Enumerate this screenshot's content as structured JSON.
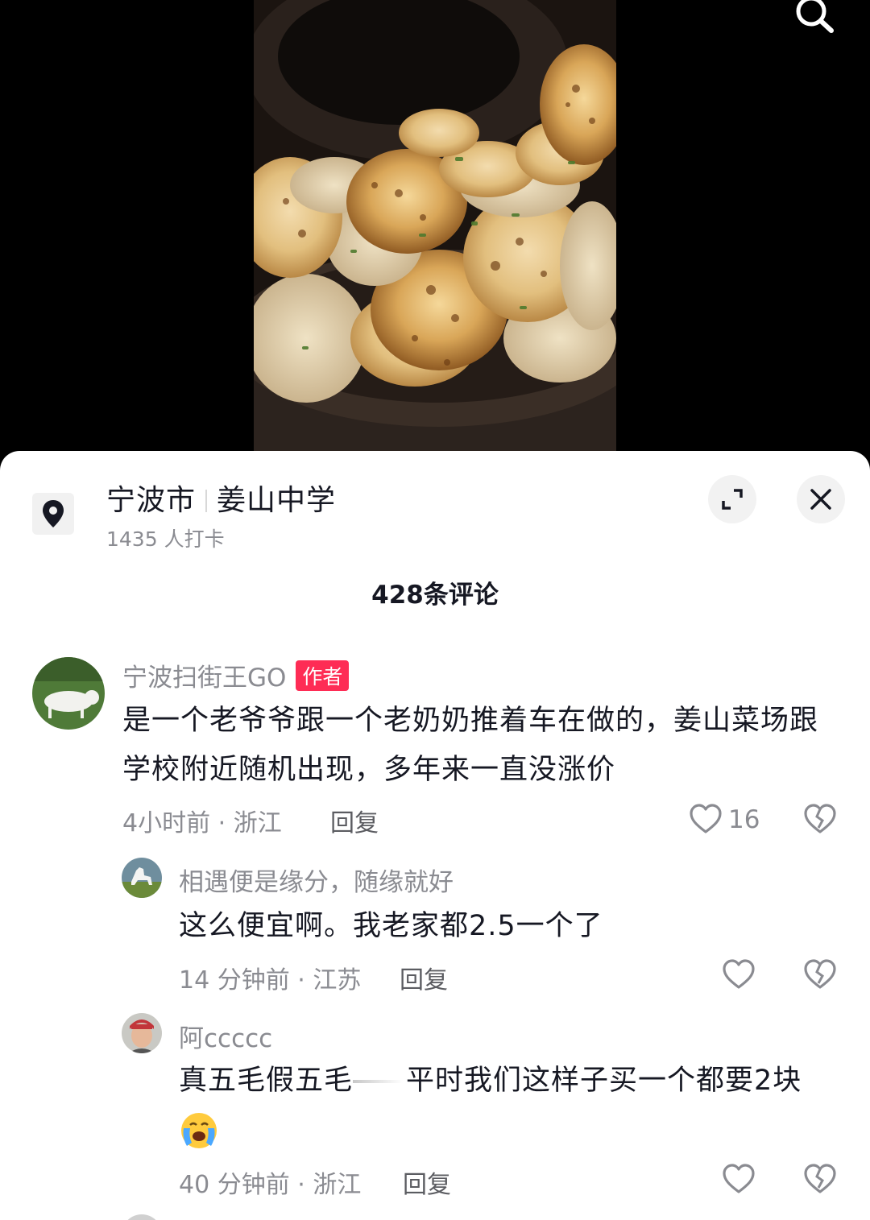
{
  "video": {
    "search_icon": "search-icon"
  },
  "location": {
    "icon": "location-pin-icon",
    "city": "宁波市",
    "place": "姜山中学",
    "checkins": "1435 人打卡"
  },
  "header": {
    "comment_count": "428条评论",
    "expand_icon": "expand-icon",
    "close_icon": "close-icon"
  },
  "comments": [
    {
      "user": "宁波扫街王GO",
      "badge": "作者",
      "text": "是一个老爷爷跟一个老奶奶推着车在做的，姜山菜场跟学校附近随机出现，多年来一直没涨价",
      "meta": "4小时前 · 浙江",
      "reply": "回复",
      "likes": "16"
    },
    {
      "user": "相遇便是缘分，随缘就好",
      "text": "这么便宜啊。我老家都2.5一个了",
      "meta": "14 分钟前 · 江苏",
      "reply": "回复"
    },
    {
      "user": "阿ccccc",
      "text_a": "真五毛假五毛",
      "text_b": "平时我们这样子买一个都要2块",
      "emoji": "crying-emoji",
      "meta": "40 分钟前 · 浙江",
      "reply": "回复"
    }
  ],
  "colors": {
    "badge": "#fe2c55",
    "text": "#161823",
    "muted": "#8a8b91"
  }
}
